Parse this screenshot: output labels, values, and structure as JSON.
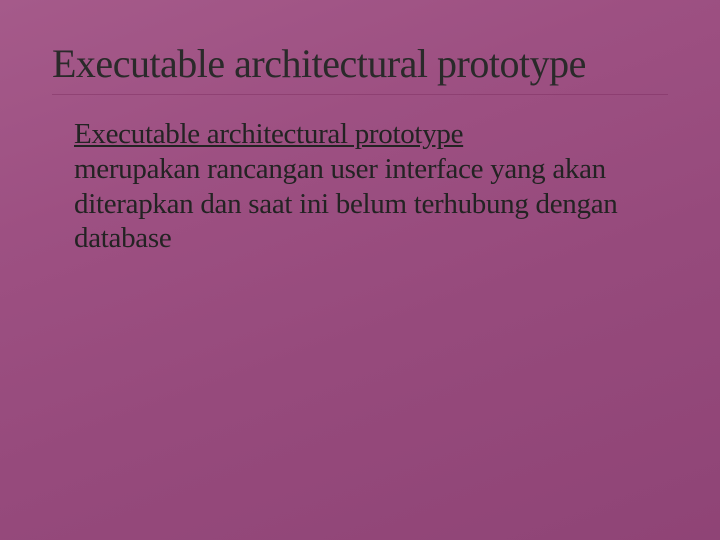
{
  "slide": {
    "title": "Executable architectural prototype",
    "subtitle": "Executable architectural prototype",
    "description": "merupakan rancangan user interface yang akan diterapkan dan saat ini belum terhubung dengan database"
  }
}
